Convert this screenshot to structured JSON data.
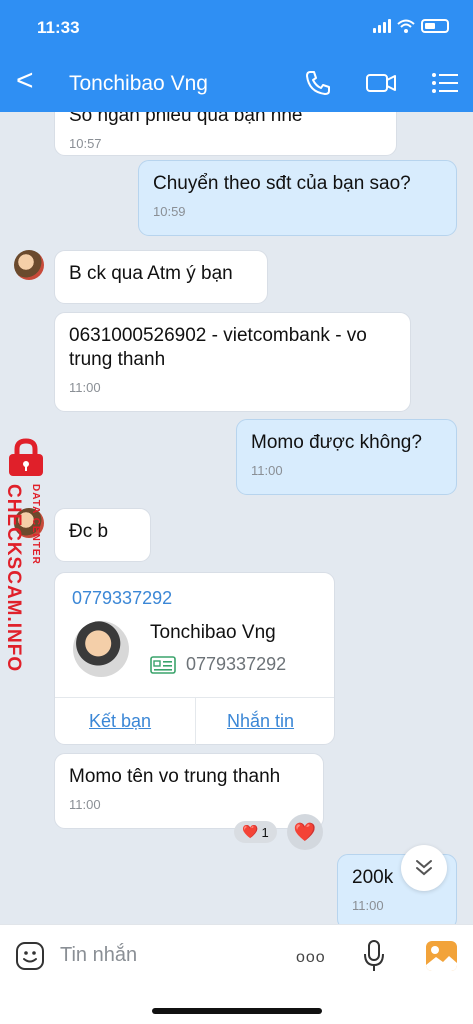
{
  "status_bar": {
    "time": "11:33"
  },
  "header": {
    "title": "Tonchibao Vng",
    "back_label": "<"
  },
  "messages": [
    {
      "text": "Số ngân phiếu qua bạn nhé",
      "time": "10:57"
    },
    {
      "text": "Chuyển theo sđt của bạn sao?",
      "time": "10:59"
    },
    {
      "text": "B ck qua Atm ý bạn"
    },
    {
      "text": "0631000526902 - vietcombank - vo trung thanh",
      "time": "11:00"
    },
    {
      "text": "Momo được không?",
      "time": "11:00"
    },
    {
      "text": "Đc b"
    },
    {
      "text": "Momo tên vo trung thanh",
      "time": "11:00"
    },
    {
      "text": "200k",
      "time": "11:00"
    }
  ],
  "contact_card": {
    "phone_link": "0779337292",
    "name": "Tonchibao Vng",
    "phone": "0779337292",
    "add_friend": "Kết bạn",
    "message": "Nhắn tin"
  },
  "reaction": {
    "emoji": "❤️",
    "count": "1",
    "button_emoji": "❤️"
  },
  "watermark": {
    "main": "CHECKSCAM.INFO",
    "sub": "DATA CENTER"
  },
  "composer": {
    "placeholder": "Tin nhắn",
    "more": "ooo"
  },
  "colors": {
    "header": "#2f8ff3",
    "my_bubble": "#d8ecfd",
    "link": "#3b87d6",
    "watermark": "#e0202a",
    "background": "#e3e9f0"
  }
}
